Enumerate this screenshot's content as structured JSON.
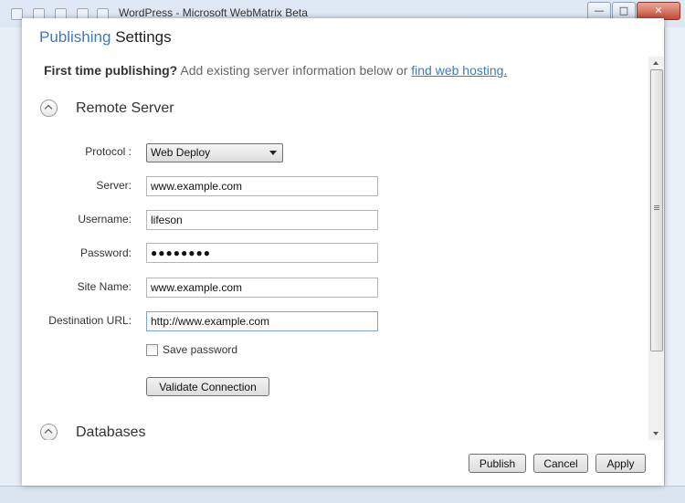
{
  "app_window": {
    "title": "WordPress - Microsoft WebMatrix Beta",
    "controls": {
      "minimize": "—",
      "maximize": "□",
      "close": "✕"
    }
  },
  "dialog": {
    "title_accent": "Publishing",
    "title_rest": "Settings",
    "intro": {
      "bold": "First time publishing?",
      "text": "Add existing server information below or",
      "link": "find web hosting."
    },
    "remote_server": {
      "header": "Remote Server",
      "protocol": {
        "label": "Protocol :",
        "value": "Web Deploy"
      },
      "server": {
        "label": "Server:",
        "value": "www.example.com"
      },
      "username": {
        "label": "Username:",
        "value": "lifeson"
      },
      "password": {
        "label": "Password:",
        "value": "●●●●●●●●"
      },
      "site_name": {
        "label": "Site Name:",
        "value": "www.example.com"
      },
      "destination_url": {
        "label": "Destination URL:",
        "value": "http://www.example.com"
      },
      "save_password": {
        "label": "Save password",
        "checked": false
      },
      "validate_button": "Validate Connection"
    },
    "databases": {
      "header": "Databases"
    },
    "buttons": {
      "publish": "Publish",
      "cancel": "Cancel",
      "apply": "Apply"
    }
  },
  "colors": {
    "accent": "#3b7bbf",
    "link": "#3b7bbf"
  }
}
